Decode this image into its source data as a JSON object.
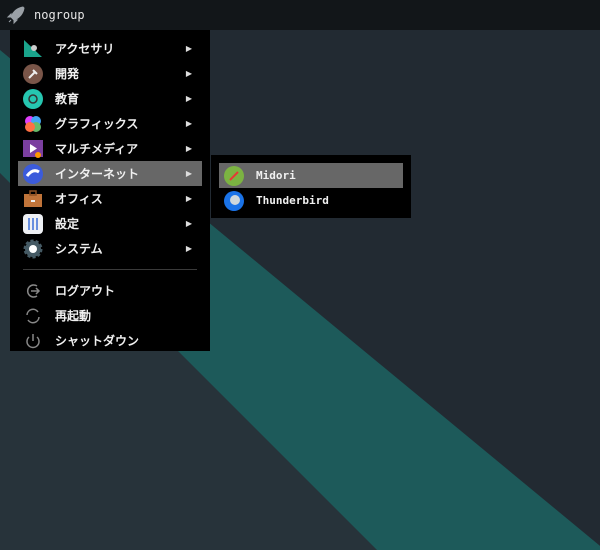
{
  "panel": {
    "title": "nogroup"
  },
  "menu": {
    "items": [
      {
        "label": "アクセサリ",
        "icon": "accessories-icon"
      },
      {
        "label": "開発",
        "icon": "development-icon"
      },
      {
        "label": "教育",
        "icon": "education-icon"
      },
      {
        "label": "グラフィックス",
        "icon": "graphics-icon"
      },
      {
        "label": "マルチメディア",
        "icon": "multimedia-icon"
      },
      {
        "label": "インターネット",
        "icon": "internet-icon"
      },
      {
        "label": "オフィス",
        "icon": "office-icon"
      },
      {
        "label": "設定",
        "icon": "settings-icon"
      },
      {
        "label": "システム",
        "icon": "system-icon"
      }
    ],
    "actions": [
      {
        "label": "ログアウト"
      },
      {
        "label": "再起動"
      },
      {
        "label": "シャットダウン"
      }
    ],
    "arrow": "▶"
  },
  "submenu": {
    "items": [
      {
        "label": "Midori"
      },
      {
        "label": "Thunderbird"
      }
    ]
  },
  "colors": {
    "teal": "#1d5a5a",
    "selected": "#676767"
  }
}
